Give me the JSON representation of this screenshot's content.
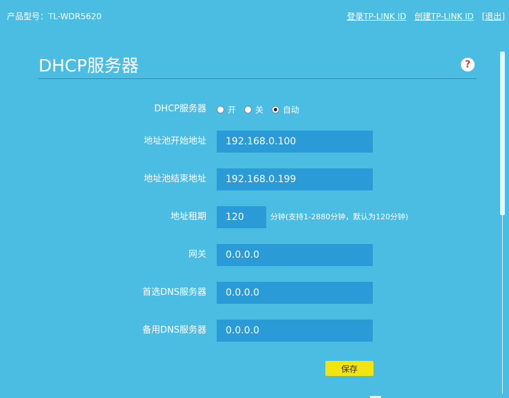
{
  "header": {
    "model_label": "产品型号：TL-WDR5620",
    "login_link": "登录TP-LINK ID",
    "create_link": "创建TP-LINK ID",
    "logout_open": "[",
    "logout_link": "退出",
    "logout_close": "]"
  },
  "page": {
    "title": "DHCP服务器",
    "help_symbol": "?"
  },
  "form": {
    "dhcp": {
      "label": "DHCP服务器",
      "options": [
        {
          "label": "开",
          "checked": false
        },
        {
          "label": "关",
          "checked": false
        },
        {
          "label": "自动",
          "checked": true
        }
      ]
    },
    "pool_start": {
      "label": "地址池开始地址",
      "value": "192.168.0.100"
    },
    "pool_end": {
      "label": "地址池结束地址",
      "value": "192.168.0.199"
    },
    "lease": {
      "label": "地址租期",
      "value": "120",
      "hint": "分钟(支持1-2880分钟，默认为120分钟)"
    },
    "gateway": {
      "label": "网关",
      "value": "0.0.0.0"
    },
    "dns_primary": {
      "label": "首选DNS服务器",
      "value": "0.0.0.0"
    },
    "dns_secondary": {
      "label": "备用DNS服务器",
      "value": "0.0.0.0"
    }
  },
  "save_label": "保存",
  "colors": {
    "background": "#4bbde3",
    "input_fill": "#2a9bd6",
    "save_button": "#f2e50f",
    "help_icon": "#e23a2e"
  }
}
